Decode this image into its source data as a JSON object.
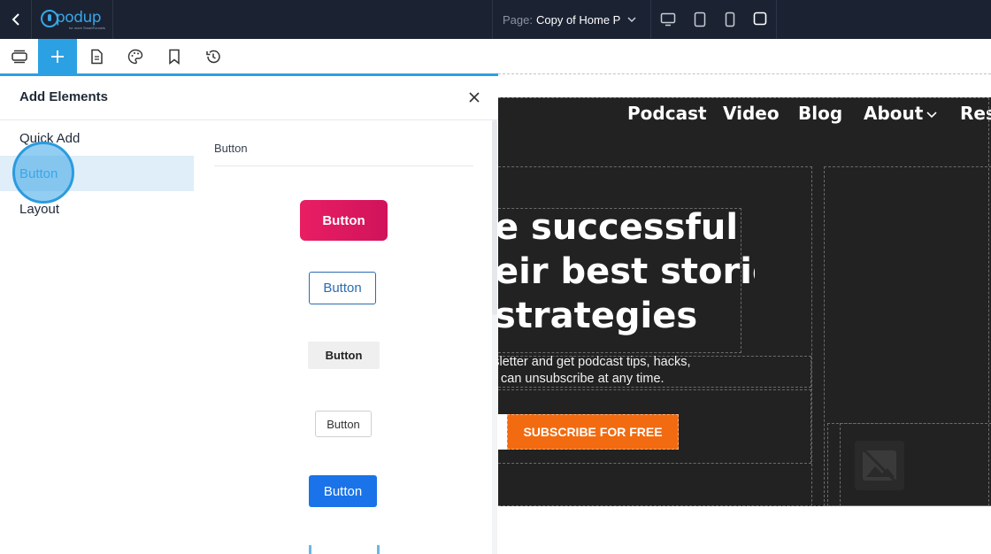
{
  "header": {
    "logo_text": "podup",
    "logo_sub": "for more SmartFunnels",
    "page_label": "Page:",
    "page_name": "Copy of Home P"
  },
  "toolbar": {
    "tools": [
      "sections-icon",
      "add-icon",
      "pages-icon",
      "theme-icon",
      "bookmark-icon",
      "history-icon"
    ],
    "active_tool": "add-icon"
  },
  "panel": {
    "title": "Add Elements",
    "categories": [
      "Quick Add",
      "Button",
      "Layout"
    ],
    "selected_category": "Button",
    "section_label": "Button",
    "buttons": [
      "Button",
      "Button",
      "Button",
      "Button",
      "Button"
    ]
  },
  "preview": {
    "nav": [
      "Podcast",
      "Video",
      "Blog",
      "About",
      "Res"
    ],
    "headline": [
      "e successful",
      "eir best stories,",
      "strategies"
    ],
    "subtext": [
      "ysletter and get podcast tips, hacks,",
      "can unsubscribe at any time."
    ],
    "cta": "SUBSCRIBE FOR FREE"
  },
  "colors": {
    "topbar": "#1b2333",
    "accent": "#2ba1e3",
    "cta": "#f26b10",
    "primary_button": "#e91e63"
  }
}
